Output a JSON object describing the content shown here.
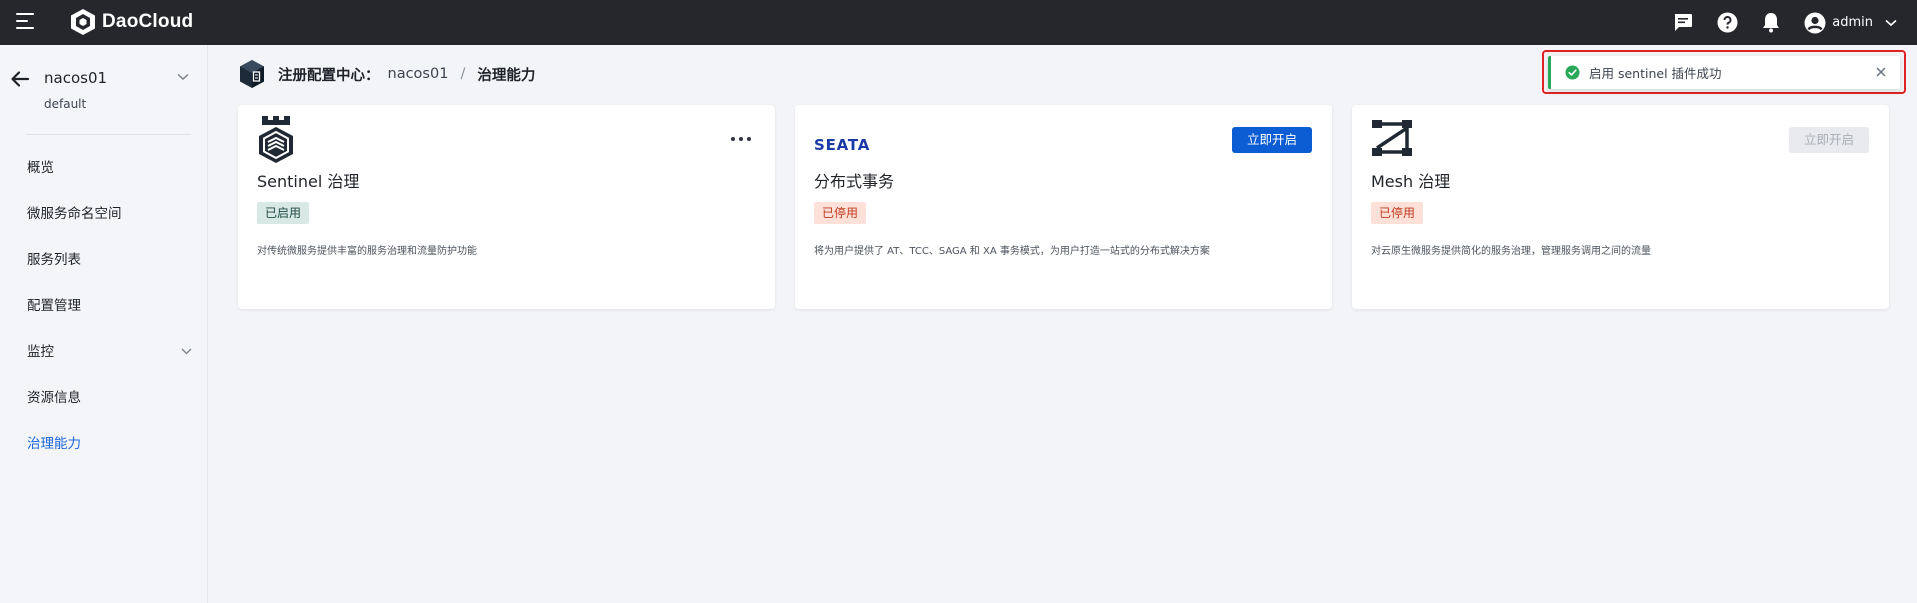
{
  "topbar": {
    "brand": "DaoCloud",
    "icons": [
      "menu-icon",
      "message-icon",
      "help-icon",
      "bell-icon",
      "user-avatar-icon",
      "chevron-down-icon"
    ],
    "user_name": "admin"
  },
  "sidebar": {
    "namespace": "nacos01",
    "sub": "default",
    "items": [
      {
        "label": "概览",
        "active": false,
        "expandable": false
      },
      {
        "label": "微服务命名空间",
        "active": false,
        "expandable": false
      },
      {
        "label": "服务列表",
        "active": false,
        "expandable": false
      },
      {
        "label": "配置管理",
        "active": false,
        "expandable": false
      },
      {
        "label": "监控",
        "active": false,
        "expandable": true
      },
      {
        "label": "资源信息",
        "active": false,
        "expandable": false
      },
      {
        "label": "治理能力",
        "active": true,
        "expandable": false
      }
    ]
  },
  "breadcrumb": {
    "label": "注册配置中心：",
    "namespace": "nacos01",
    "separator": "/",
    "current": "治理能力"
  },
  "cards": [
    {
      "title": "Sentinel 治理",
      "status": "已启用",
      "status_kind": "on",
      "description": "对传统微服务提供丰富的服务治理和流量防护功能",
      "action": "more",
      "logo": "sentinel-logo"
    },
    {
      "title": "分布式事务",
      "status": "已停用",
      "status_kind": "off",
      "description": "将为用户提供了 AT、TCC、SAGA 和 XA 事务模式，为用户打造一站式的分布式解决方案",
      "action": "立即开启",
      "action_enabled": true,
      "logo": "seata-logo",
      "logo_text": "SEATA"
    },
    {
      "title": "Mesh 治理",
      "status": "已停用",
      "status_kind": "off",
      "description": "对云原生微服务提供简化的服务治理，管理服务调用之间的流量",
      "action": "立即开启",
      "action_enabled": false,
      "logo": "mesh-logo"
    }
  ],
  "toast": {
    "message": "启用 sentinel 插件成功",
    "type": "success"
  },
  "colors": {
    "topbar": "#25272d",
    "accent": "#1a66d9",
    "primary_button": "#0c5cd3",
    "success": "#2aa85a",
    "highlight": "#e02424"
  }
}
